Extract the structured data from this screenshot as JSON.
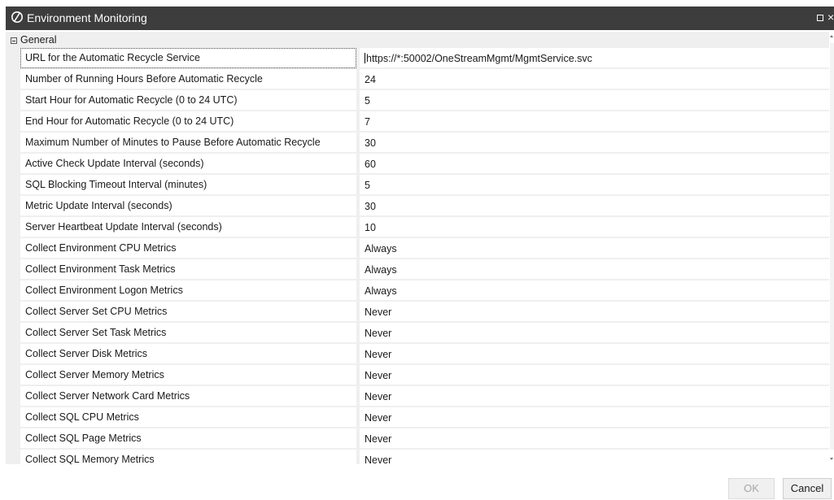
{
  "window": {
    "title": "Environment Monitoring",
    "app_icon": "onestream-logo-icon",
    "maximize_icon": "maximize-icon",
    "close_icon": "close-icon",
    "close_glyph": "×"
  },
  "grid": {
    "category": {
      "label": "General",
      "expander_icon": "collapse-icon"
    },
    "properties": [
      {
        "name": "URL for the Automatic Recycle Service",
        "value": "https://*:50002/OneStreamMgmt/MgmtService.svc"
      },
      {
        "name": "Number of Running Hours Before Automatic Recycle",
        "value": "24"
      },
      {
        "name": "Start Hour for Automatic Recycle (0 to 24 UTC)",
        "value": "5"
      },
      {
        "name": "End Hour for Automatic Recycle (0 to 24 UTC)",
        "value": "7"
      },
      {
        "name": "Maximum Number of Minutes to Pause Before Automatic Recycle",
        "value": "30"
      },
      {
        "name": "Active Check Update Interval (seconds)",
        "value": "60"
      },
      {
        "name": "SQL Blocking Timeout Interval (minutes)",
        "value": "5"
      },
      {
        "name": "Metric Update Interval (seconds)",
        "value": "30"
      },
      {
        "name": "Server Heartbeat Update Interval (seconds)",
        "value": "10"
      },
      {
        "name": "Collect Environment CPU Metrics",
        "value": "Always"
      },
      {
        "name": "Collect Environment Task Metrics",
        "value": "Always"
      },
      {
        "name": "Collect Environment Logon Metrics",
        "value": "Always"
      },
      {
        "name": "Collect Server Set CPU Metrics",
        "value": "Never"
      },
      {
        "name": "Collect Server Set Task Metrics",
        "value": "Never"
      },
      {
        "name": "Collect Server Disk Metrics",
        "value": "Never"
      },
      {
        "name": "Collect Server Memory Metrics",
        "value": "Never"
      },
      {
        "name": "Collect Server Network Card Metrics",
        "value": "Never"
      },
      {
        "name": "Collect SQL CPU Metrics",
        "value": "Never"
      },
      {
        "name": "Collect SQL Page Metrics",
        "value": "Never"
      },
      {
        "name": "Collect SQL Memory Metrics",
        "value": "Never"
      }
    ]
  },
  "buttons": {
    "ok_label": "OK",
    "ok_enabled": false,
    "cancel_label": "Cancel"
  }
}
